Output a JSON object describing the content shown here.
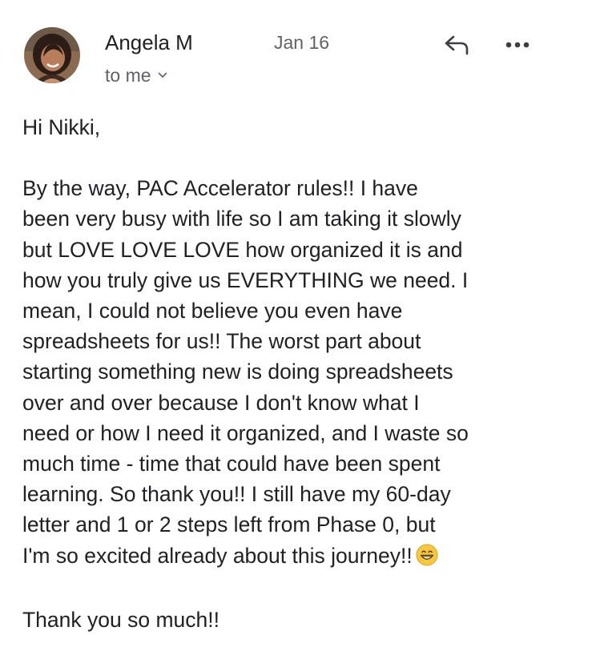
{
  "header": {
    "sender_name": "Angela M",
    "recipient_label": "to me",
    "date": "Jan 16",
    "avatar_icon": "avatar-photo",
    "reply_icon": "reply-icon",
    "more_icon": "more-options-icon",
    "chevron_icon": "chevron-down-icon"
  },
  "message": {
    "greeting": "Hi Nikki,",
    "body_lines": [
      "By the way, PAC Accelerator rules!!  I have",
      "been very busy with life so I am taking it slowly",
      "but LOVE LOVE LOVE how organized it is and",
      "how you truly give us EVERYTHING we need.  I",
      "mean, I could not believe you even have",
      "spreadsheets for us!!  The worst part about",
      "starting something new is doing spreadsheets",
      "over and over because I don't know what I",
      "need or how I need it organized, and I waste so",
      "much time - time that could have been spent",
      "learning.  So thank you!!  I still have my 60-day",
      "letter and 1 or 2 steps left from Phase 0, but",
      "I'm so excited already about this journey!!"
    ],
    "emoji": "grinning-face-emoji",
    "closing": "Thank you so much!!"
  },
  "colors": {
    "text_primary": "#202124",
    "text_secondary": "#5f6368",
    "emoji_yellow": "#f7c73c"
  }
}
